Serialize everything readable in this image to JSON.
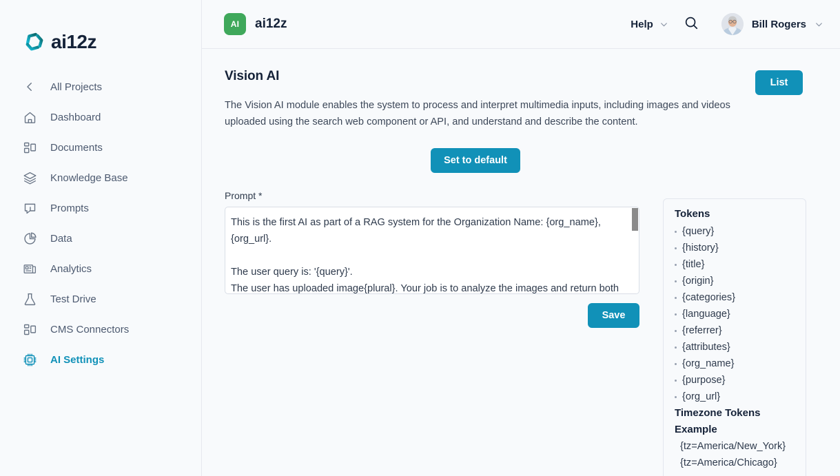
{
  "brand": {
    "logo_text": "ai12z",
    "logo_icon": "ai12z-pinwheel-logo",
    "accent_color": "#1191b8",
    "logo_gradient_from": "#13b9d6",
    "logo_gradient_to": "#0f6e6a"
  },
  "sidebar": {
    "items": [
      {
        "label": "All Projects",
        "icon": "chevron-left-icon",
        "active": false
      },
      {
        "label": "Dashboard",
        "icon": "home-icon",
        "active": false
      },
      {
        "label": "Documents",
        "icon": "documents-icon",
        "active": false
      },
      {
        "label": "Knowledge Base",
        "icon": "layers-icon",
        "active": false
      },
      {
        "label": "Prompts",
        "icon": "chat-bubble-icon",
        "active": false
      },
      {
        "label": "Data",
        "icon": "pie-chart-icon",
        "active": false
      },
      {
        "label": "Analytics",
        "icon": "analytics-report-icon",
        "active": false
      },
      {
        "label": "Test Drive",
        "icon": "flask-icon",
        "active": false
      },
      {
        "label": "CMS Connectors",
        "icon": "connectors-icon",
        "active": false
      },
      {
        "label": "AI Settings",
        "icon": "chip-icon",
        "active": true
      }
    ]
  },
  "topbar": {
    "org_badge": "AI",
    "org_badge_color": "#3fa85b",
    "org_name": "ai12z",
    "help_label": "Help",
    "help_chevron_icon": "chevron-down-icon",
    "search_icon": "search-icon",
    "avatar_icon": "user-avatar-photo",
    "user_name": "Bill Rogers",
    "user_chevron_icon": "chevron-down-icon"
  },
  "page": {
    "title": "Vision AI",
    "description": "The Vision AI module enables the system to process and interpret multimedia inputs, including images and videos uploaded using the search web component or API, and understand and describe the content.",
    "list_button": "List",
    "set_default_button": "Set to default",
    "save_button": "Save"
  },
  "prompt": {
    "label": "Prompt *",
    "value": "This is the first AI as part of a RAG system for the Organization Name: {org_name}, {org_url}.\n\nThe user query is: '{query}'.\nThe user has uploaded image{plural}. Your job is to analyze the images and return both a"
  },
  "tokens": {
    "title": "Tokens",
    "items": [
      "{query}",
      "{history}",
      "{title}",
      "{origin}",
      "{categories}",
      "{language}",
      "{referrer}",
      "{attributes}",
      "{org_name}",
      "{purpose}",
      "{org_url}"
    ],
    "subtitle_line1": "Timezone Tokens",
    "subtitle_line2": "Example",
    "examples": [
      "{tz=America/New_York}",
      "{tz=America/Chicago}"
    ]
  }
}
